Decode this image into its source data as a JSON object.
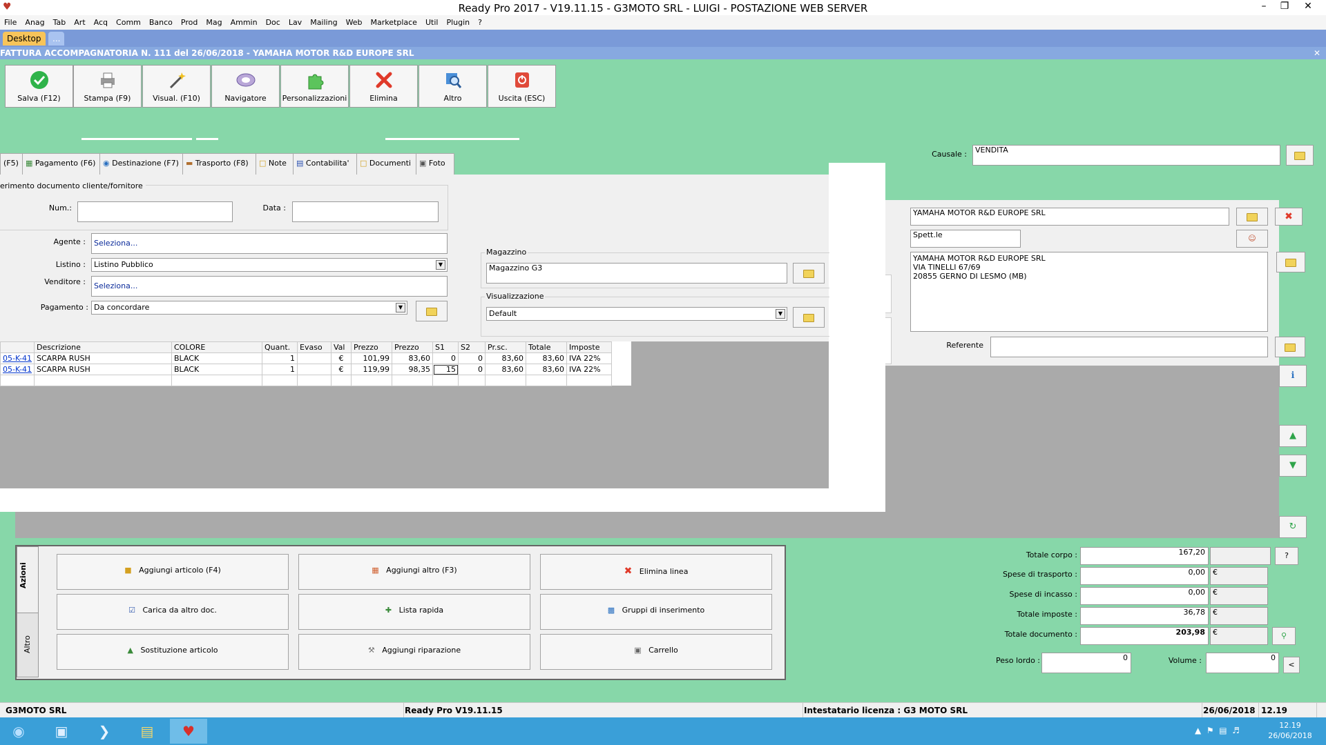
{
  "window": {
    "title": "Ready Pro 2017 - V19.11.15 - G3MOTO SRL - LUIGI - POSTAZIONE WEB SERVER"
  },
  "menu": [
    "File",
    "Anag",
    "Tab",
    "Art",
    "Acq",
    "Comm",
    "Banco",
    "Prod",
    "Mag",
    "Ammin",
    "Doc",
    "Lav",
    "Mailing",
    "Web",
    "Marketplace",
    "Util",
    "Plugin",
    "?"
  ],
  "desktop_tabs": {
    "desktop": "Desktop",
    "more": "..."
  },
  "doc_title": "FATTURA ACCOMPAGNATORIA N. 111 del 26/06/2018 - YAMAHA MOTOR R&D EUROPE SRL",
  "toolbar": {
    "save": "Salva (F12)",
    "print": "Stampa (F9)",
    "view": "Visual. (F10)",
    "navigator": "Navigatore",
    "custom": "Personalizzazioni",
    "delete": "Elimina",
    "other": "Altro",
    "exit": "Uscita (ESC)"
  },
  "form_tabs": [
    "(F5)",
    "Pagamento (F6)",
    "Destinazione (F7)",
    "Trasporto (F8)",
    "Note",
    "Contabilita'",
    "Documenti",
    "Foto"
  ],
  "causale": {
    "label": "Causale :",
    "value": "VENDITA"
  },
  "ref_doc": {
    "group": "erimento documento cliente/fornitore",
    "num_label": "Num.:",
    "num_value": "",
    "date_label": "Data :",
    "date_value": ""
  },
  "agente": {
    "label": "Agente :",
    "value": "Seleziona..."
  },
  "listino": {
    "label": "Listino :",
    "value": "Listino Pubblico"
  },
  "venditore": {
    "label": "Venditore :",
    "value": "Seleziona..."
  },
  "pagamento": {
    "label": "Pagamento :",
    "value": "Da concordare"
  },
  "magazzino": {
    "group": "Magazzino",
    "value": "Magazzino G3"
  },
  "visualizzazione": {
    "group": "Visualizzazione",
    "value": "Default"
  },
  "customer": {
    "name": "YAMAHA MOTOR R&D EUROPE SRL",
    "title": "Spett.le",
    "address_lines": [
      "YAMAHA MOTOR R&D EUROPE SRL",
      "VIA TINELLI 67/69",
      "20855 GERNO DI LESMO  (MB)"
    ],
    "referente_label": "Referente",
    "referente_value": ""
  },
  "grid": {
    "headers": [
      "",
      "Descrizione",
      "COLORE",
      "Quant.",
      "Evaso",
      "Val",
      "Prezzo",
      "Prezzo",
      "S1",
      "S2",
      "Pr.sc.",
      "Totale",
      "Imposte"
    ],
    "rows": [
      [
        "05-K-41",
        "SCARPA RUSH",
        "BLACK",
        "1",
        "",
        "€",
        "101,99",
        "83,60",
        "0",
        "0",
        "83,60",
        "83,60",
        "IVA 22%"
      ],
      [
        "05-K-41",
        "SCARPA RUSH",
        "BLACK",
        "1",
        "",
        "€",
        "119,99",
        "98,35",
        "15",
        "0",
        "83,60",
        "83,60",
        "IVA 22%"
      ]
    ]
  },
  "actions": {
    "tab_azioni": "Azioni",
    "tab_altro": "Altro",
    "add_article": "Aggiungi articolo (F4)",
    "add_other": "Aggiungi altro (F3)",
    "delete_line": "Elimina linea",
    "load_other": "Carica da altro doc.",
    "quick_list": "Lista rapida",
    "insert_groups": "Gruppi di inserimento",
    "replace_article": "Sostituzione articolo",
    "add_repair": "Aggiungi riparazione",
    "cart": "Carrello"
  },
  "totals": {
    "corpo_label": "Totale corpo :",
    "corpo": "167,20",
    "trasporto_label": "Spese di trasporto :",
    "trasporto": "0,00",
    "incasso_label": "Spese di incasso :",
    "incasso": "0,00",
    "imposte_label": "Totale imposte :",
    "imposte": "36,78",
    "documento_label": "Totale documento :",
    "documento": "203,98",
    "currency": "€",
    "help": "?",
    "peso_label": "Peso lordo :",
    "peso": "0",
    "volume_label": "Volume :",
    "volume": "0",
    "less": "<"
  },
  "status": {
    "company": "G3MOTO SRL",
    "version": "Ready Pro V19.11.15",
    "license": "Intestatario licenza : G3 MOTO SRL",
    "date": "26/06/2018",
    "time": "12.19"
  },
  "taskbar": {
    "time": "12.19",
    "date": "26/06/2018"
  },
  "colors": {
    "workspace_green": "#87d7a9",
    "title_blue": "#87a9e0",
    "taskbar_blue": "#3a9fd8"
  }
}
